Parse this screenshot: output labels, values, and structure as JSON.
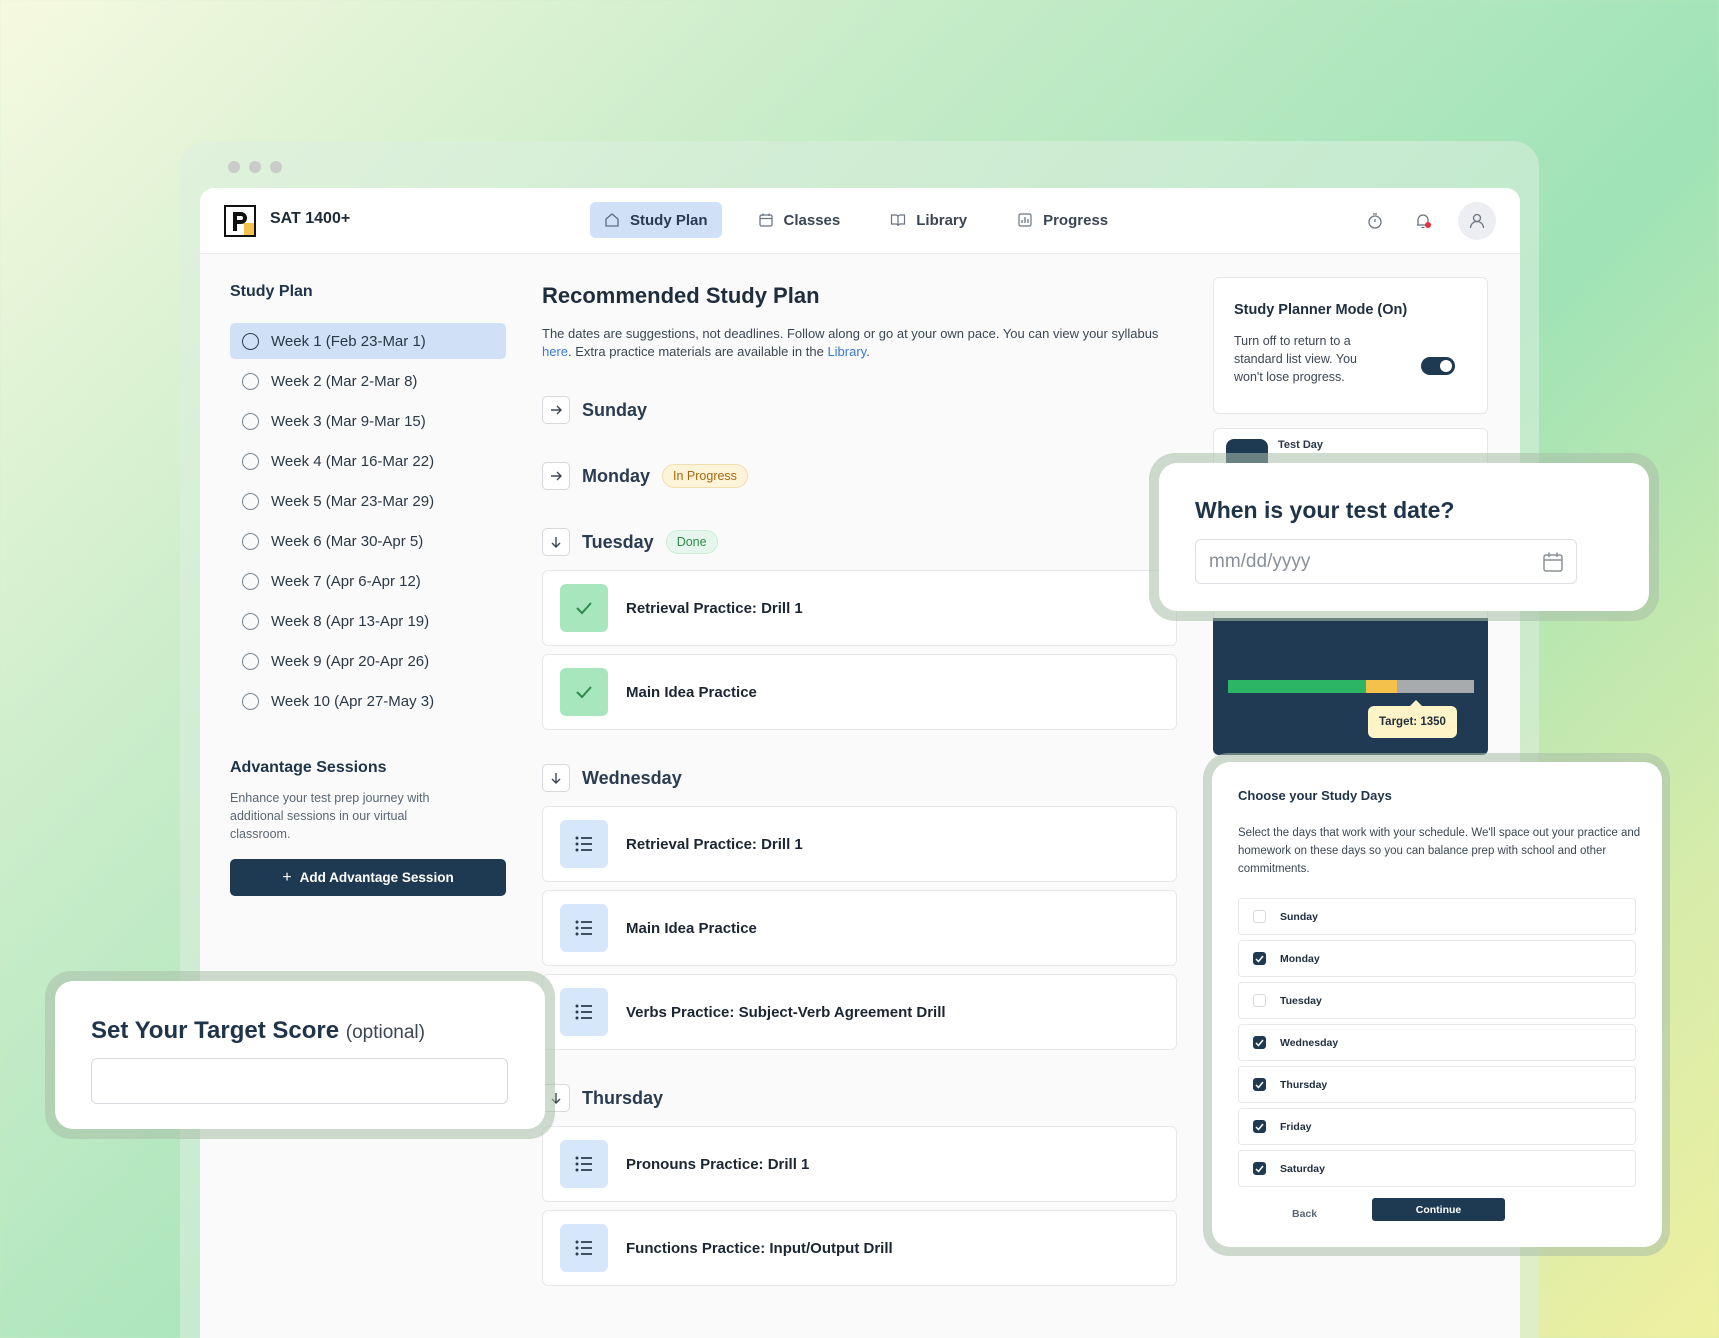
{
  "app": {
    "brand": "SAT 1400+"
  },
  "nav": {
    "items": [
      {
        "label": "Study Plan",
        "icon": "home-icon",
        "active": true
      },
      {
        "label": "Classes",
        "icon": "calendar-icon",
        "active": false
      },
      {
        "label": "Library",
        "icon": "book-icon",
        "active": false
      },
      {
        "label": "Progress",
        "icon": "chart-icon",
        "active": false
      }
    ]
  },
  "sidebar": {
    "title": "Study Plan",
    "weeks": [
      "Week 1 (Feb 23-Mar 1)",
      "Week 2 (Mar 2-Mar 8)",
      "Week 3 (Mar 9-Mar 15)",
      "Week 4 (Mar 16-Mar 22)",
      "Week 5 (Mar 23-Mar 29)",
      "Week 6 (Mar 30-Apr 5)",
      "Week 7 (Apr 6-Apr 12)",
      "Week 8 (Apr 13-Apr 19)",
      "Week 9 (Apr 20-Apr 26)",
      "Week 10 (Apr 27-May 3)"
    ],
    "advantage": {
      "title": "Advantage Sessions",
      "desc": "Enhance your test prep journey with additional sessions in our virtual classroom.",
      "button": "Add Advantage Session"
    }
  },
  "main": {
    "title": "Recommended Study Plan",
    "desc_1": "The dates are suggestions, not deadlines. Follow along or go at your own pace. You can view your syllabus ",
    "link_here": "here",
    "desc_2": ". Extra practice materials are available in the ",
    "link_library": "Library",
    "desc_3": ".",
    "days": {
      "sunday": "Sunday",
      "monday": "Monday",
      "monday_badge": "In Progress",
      "tuesday": "Tuesday",
      "tuesday_badge": "Done",
      "wednesday": "Wednesday",
      "thursday": "Thursday"
    },
    "tasks": {
      "tue_1": "Retrieval Practice: Drill 1",
      "tue_2": "Main Idea Practice",
      "wed_1": "Retrieval Practice: Drill 1",
      "wed_2": "Main Idea Practice",
      "wed_3": "Verbs Practice: Subject-Verb Agreement Drill",
      "thu_1": "Pronouns Practice: Drill 1",
      "thu_2": "Functions Practice: Input/Output Drill"
    }
  },
  "planner": {
    "title": "Study Planner Mode (On)",
    "desc": "Turn off to return to a standard list view. You won't lose progress.",
    "toggle_on": true
  },
  "test_day": {
    "label": "Test Day",
    "target_label": "Target: 1350"
  },
  "test_date_modal": {
    "title": "When is your test date?",
    "placeholder": "mm/dd/yyyy"
  },
  "target_modal": {
    "title": "Set Your Target Score",
    "optional": "(optional)"
  },
  "study_days_modal": {
    "title": "Choose your Study Days",
    "desc": "Select the days that work with your schedule. We'll space out your practice and homework on these days so you can balance prep with school and other commitments.",
    "days": [
      {
        "label": "Sunday",
        "checked": false
      },
      {
        "label": "Monday",
        "checked": true
      },
      {
        "label": "Tuesday",
        "checked": false
      },
      {
        "label": "Wednesday",
        "checked": true
      },
      {
        "label": "Thursday",
        "checked": true
      },
      {
        "label": "Friday",
        "checked": true
      },
      {
        "label": "Saturday",
        "checked": true
      }
    ],
    "back": "Back",
    "continue": "Continue"
  },
  "colors": {
    "navy": "#1e3a52",
    "active_blue": "#cfe0f7",
    "done_green": "#2db566",
    "target_yellow": "#f4c24a"
  }
}
